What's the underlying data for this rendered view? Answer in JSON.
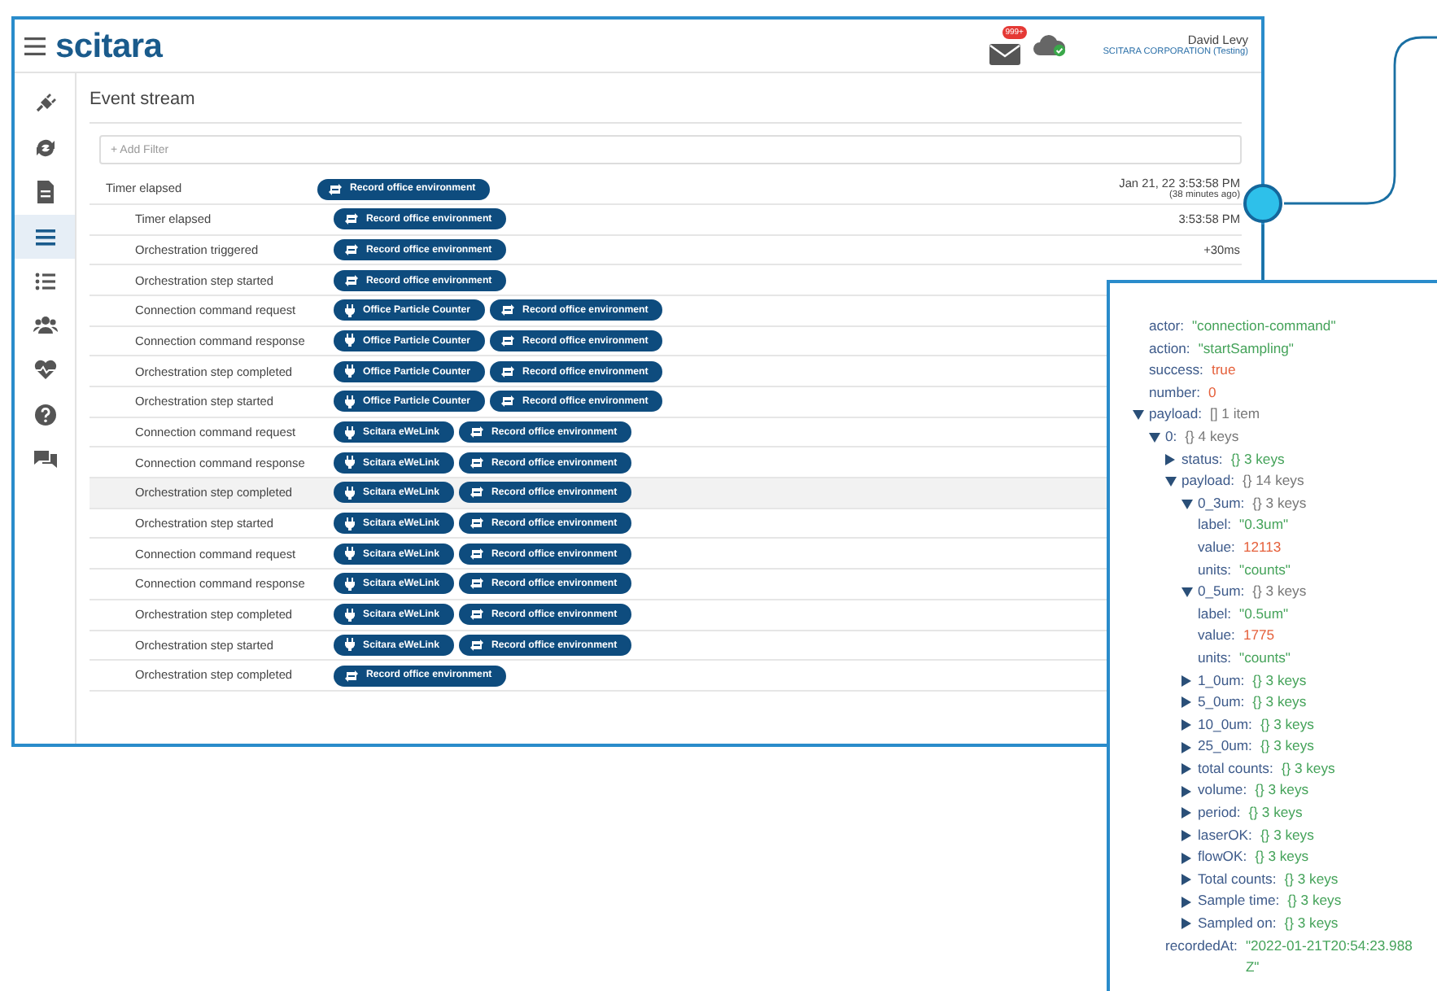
{
  "header": {
    "logo": "scitara",
    "mail_badge": "999+",
    "user_name": "David Levy",
    "organization": "SCITARA CORPORATION (Testing)"
  },
  "sidebar": {
    "items": [
      {
        "selected": false
      },
      {
        "selected": false
      },
      {
        "selected": false
      },
      {
        "selected": true
      },
      {
        "selected": false
      },
      {
        "selected": false
      },
      {
        "selected": false
      },
      {
        "selected": false
      },
      {
        "selected": false
      }
    ]
  },
  "page_title": "Event stream",
  "filter": {
    "placeholder": "+ Add Filter"
  },
  "events": [
    {
      "label": "Timer elapsed",
      "selected": false,
      "time": "Jan 21, 22 3:53:58 PM",
      "time_note": "(38 minutes ago)",
      "tags": [
        {
          "kind": "orchestration",
          "text": "Record office environment"
        }
      ],
      "children": [
        {
          "label": "Timer elapsed",
          "selected": false,
          "time": "3:53:58 PM",
          "tags": [
            {
              "kind": "orchestration",
              "text": "Record office environment"
            }
          ]
        },
        {
          "label": "Orchestration triggered",
          "selected": false,
          "time": "+30ms",
          "tags": [
            {
              "kind": "orchestration",
              "text": "Record office environment"
            }
          ]
        },
        {
          "label": "Orchestration step started",
          "selected": false,
          "tags": [
            {
              "kind": "orchestration",
              "text": "Record office environment"
            }
          ]
        },
        {
          "label": "Connection command request",
          "selected": false,
          "tags": [
            {
              "kind": "connection",
              "text": "Office Particle Counter"
            },
            {
              "kind": "orchestration",
              "text": "Record office environment"
            }
          ]
        },
        {
          "label": "Connection command response",
          "selected": false,
          "tags": [
            {
              "kind": "connection",
              "text": "Office Particle Counter"
            },
            {
              "kind": "orchestration",
              "text": "Record office environment"
            }
          ]
        },
        {
          "label": "Orchestration step completed",
          "selected": false,
          "tags": [
            {
              "kind": "connection",
              "text": "Office Particle Counter"
            },
            {
              "kind": "orchestration",
              "text": "Record office environment"
            }
          ]
        },
        {
          "label": "Orchestration step started",
          "selected": false,
          "tags": [
            {
              "kind": "connection",
              "text": "Office Particle Counter"
            },
            {
              "kind": "orchestration",
              "text": "Record office environment"
            }
          ]
        },
        {
          "label": "Connection command request",
          "selected": false,
          "tags": [
            {
              "kind": "connection",
              "text": "Scitara eWeLink"
            },
            {
              "kind": "orchestration",
              "text": "Record office environment"
            }
          ]
        },
        {
          "label": "Connection command response",
          "selected": false,
          "tags": [
            {
              "kind": "connection",
              "text": "Scitara eWeLink"
            },
            {
              "kind": "orchestration",
              "text": "Record office environment"
            }
          ]
        },
        {
          "label": "Orchestration step completed",
          "selected": true,
          "tags": [
            {
              "kind": "connection",
              "text": "Scitara eWeLink"
            },
            {
              "kind": "orchestration",
              "text": "Record office environment"
            }
          ]
        },
        {
          "label": "Orchestration step started",
          "selected": false,
          "tags": [
            {
              "kind": "connection",
              "text": "Scitara eWeLink"
            },
            {
              "kind": "orchestration",
              "text": "Record office environment"
            }
          ]
        },
        {
          "label": "Connection command request",
          "selected": false,
          "tags": [
            {
              "kind": "connection",
              "text": "Scitara eWeLink"
            },
            {
              "kind": "orchestration",
              "text": "Record office environment"
            }
          ]
        },
        {
          "label": "Connection command response",
          "selected": false,
          "tags": [
            {
              "kind": "connection",
              "text": "Scitara eWeLink"
            },
            {
              "kind": "orchestration",
              "text": "Record office environment"
            }
          ]
        },
        {
          "label": "Orchestration step completed",
          "selected": false,
          "tags": [
            {
              "kind": "connection",
              "text": "Scitara eWeLink"
            },
            {
              "kind": "orchestration",
              "text": "Record office environment"
            }
          ]
        },
        {
          "label": "Orchestration step started",
          "selected": false,
          "tags": [
            {
              "kind": "connection",
              "text": "Scitara eWeLink"
            },
            {
              "kind": "orchestration",
              "text": "Record office environment"
            }
          ]
        },
        {
          "label": "Orchestration step completed",
          "selected": false,
          "tags": [
            {
              "kind": "orchestration",
              "text": "Record office environment"
            }
          ]
        }
      ]
    }
  ],
  "inspector": {
    "nodes": [
      {
        "key": "actor:",
        "value": "\"connection-command\"",
        "kind": "string"
      },
      {
        "key": "action:",
        "value": "\"startSampling\"",
        "kind": "string"
      },
      {
        "key": "success:",
        "value": "true",
        "kind": "literal"
      },
      {
        "key": "number:",
        "value": "0",
        "kind": "literal"
      },
      {
        "key": "payload:",
        "kind": "group",
        "summary": "[] 1 item",
        "expanded": true,
        "children": [
          {
            "key": "0:",
            "kind": "group",
            "summary": "{} 4 keys",
            "expanded": true,
            "children": [
              {
                "key": "status:",
                "kind": "group",
                "summary": "{} 3 keys",
                "expanded": false
              },
              {
                "key": "payload:",
                "kind": "group",
                "summary": "{} 14 keys",
                "expanded": true,
                "children": [
                  {
                    "key": "0_3um:",
                    "kind": "group",
                    "summary": "{} 3 keys",
                    "expanded": true,
                    "children": [
                      {
                        "key": "label:",
                        "value": "\"0.3um\"",
                        "kind": "string"
                      },
                      {
                        "key": "value:",
                        "value": "12113",
                        "kind": "literal"
                      },
                      {
                        "key": "units:",
                        "value": "\"counts\"",
                        "kind": "string"
                      }
                    ]
                  },
                  {
                    "key": "0_5um:",
                    "kind": "group",
                    "summary": "{} 3 keys",
                    "expanded": true,
                    "children": [
                      {
                        "key": "label:",
                        "value": "\"0.5um\"",
                        "kind": "string"
                      },
                      {
                        "key": "value:",
                        "value": "1775",
                        "kind": "literal"
                      },
                      {
                        "key": "units:",
                        "value": "\"counts\"",
                        "kind": "string"
                      }
                    ]
                  },
                  {
                    "key": "1_0um:",
                    "kind": "group",
                    "summary": "{} 3 keys",
                    "expanded": false
                  },
                  {
                    "key": "5_0um:",
                    "kind": "group",
                    "summary": "{} 3 keys",
                    "expanded": false
                  },
                  {
                    "key": "10_0um:",
                    "kind": "group",
                    "summary": "{} 3 keys",
                    "expanded": false
                  },
                  {
                    "key": "25_0um:",
                    "kind": "group",
                    "summary": "{} 3 keys",
                    "expanded": false
                  },
                  {
                    "key": "total counts:",
                    "kind": "group",
                    "summary": "{} 3 keys",
                    "expanded": false
                  },
                  {
                    "key": "volume:",
                    "kind": "group",
                    "summary": "{} 3 keys",
                    "expanded": false
                  },
                  {
                    "key": "period:",
                    "kind": "group",
                    "summary": "{} 3 keys",
                    "expanded": false
                  },
                  {
                    "key": "laserOK:",
                    "kind": "group",
                    "summary": "{} 3 keys",
                    "expanded": false
                  },
                  {
                    "key": "flowOK:",
                    "kind": "group",
                    "summary": "{} 3 keys",
                    "expanded": false
                  },
                  {
                    "key": "Total counts:",
                    "kind": "group",
                    "summary": "{} 3 keys",
                    "expanded": false
                  },
                  {
                    "key": "Sample time:",
                    "kind": "group",
                    "summary": "{} 3 keys",
                    "expanded": false
                  },
                  {
                    "key": "Sampled on:",
                    "kind": "group",
                    "summary": "{} 3 keys",
                    "expanded": false
                  }
                ]
              },
              {
                "key": "recordedAt:",
                "value": "\"2022-01-21T20:54:23.988Z\"",
                "kind": "string"
              }
            ]
          }
        ]
      }
    ]
  }
}
